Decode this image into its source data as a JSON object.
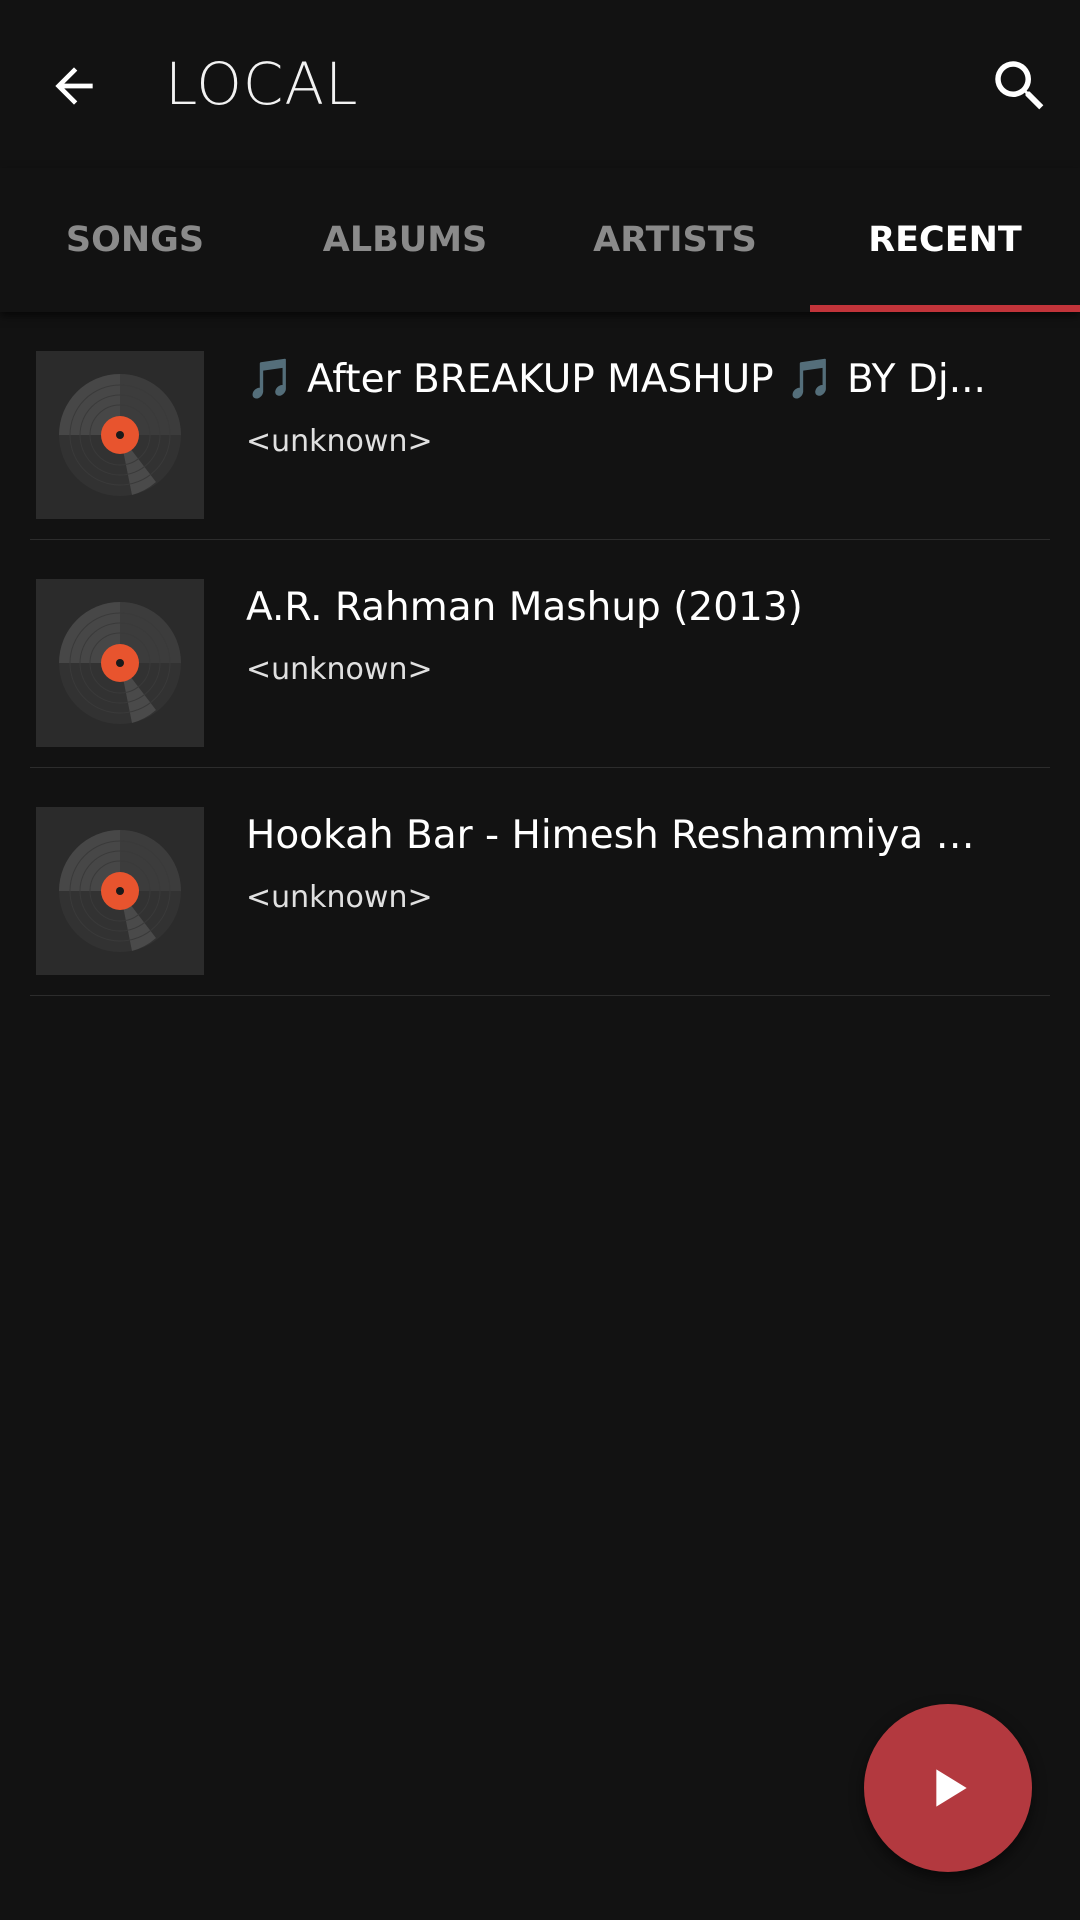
{
  "app_bar": {
    "title": "LOCAL",
    "back_icon": "arrow-back-icon",
    "search_icon": "search-icon"
  },
  "tabs": [
    {
      "label": "SONGS",
      "active": false
    },
    {
      "label": "ALBUMS",
      "active": false
    },
    {
      "label": "ARTISTS",
      "active": false
    },
    {
      "label": "RECENT",
      "active": true
    }
  ],
  "songs": [
    {
      "title": "🎵 After BREAKUP MASHUP 🎵 BY Dj...",
      "artist": "<unknown>",
      "art_icon": "vinyl-record-icon"
    },
    {
      "title": "A.R. Rahman Mashup (2013)",
      "artist": "<unknown>",
      "art_icon": "vinyl-record-icon"
    },
    {
      "title": "Hookah Bar - Himesh Reshammiya &...",
      "artist": "<unknown>",
      "art_icon": "vinyl-record-icon"
    }
  ],
  "fab": {
    "icon": "play-icon"
  },
  "colors": {
    "background": "#121212",
    "accent": "#c2343a",
    "fab": "#b3393f",
    "record_label": "#e8542e",
    "tab_inactive": "#8a8a8a",
    "tab_active": "#ffffff"
  }
}
